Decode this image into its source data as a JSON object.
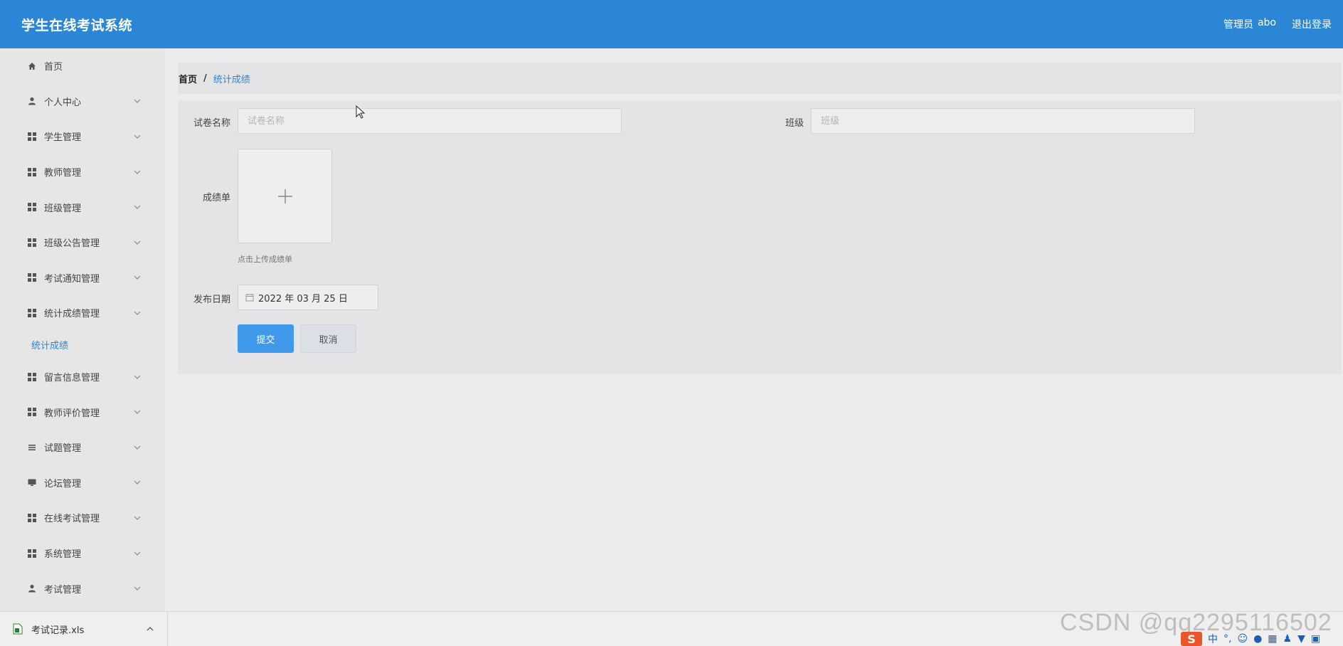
{
  "app": {
    "title": "学生在线考试系统",
    "admin_label": "管理员",
    "admin_name": "abo",
    "logout": "退出登录"
  },
  "sidebar": {
    "items": [
      {
        "label": "首页",
        "icon": "home-icon"
      },
      {
        "label": "个人中心",
        "icon": "user-icon"
      },
      {
        "label": "学生管理",
        "icon": "grid-icon"
      },
      {
        "label": "教师管理",
        "icon": "grid-icon"
      },
      {
        "label": "班级管理",
        "icon": "grid-icon"
      },
      {
        "label": "班级公告管理",
        "icon": "grid-icon"
      },
      {
        "label": "考试通知管理",
        "icon": "grid-icon"
      },
      {
        "label": "统计成绩管理",
        "icon": "grid-icon"
      },
      {
        "label": "统计成绩",
        "icon": ""
      },
      {
        "label": "留言信息管理",
        "icon": "grid-icon"
      },
      {
        "label": "教师评价管理",
        "icon": "grid-icon"
      },
      {
        "label": "试题管理",
        "icon": "list-icon"
      },
      {
        "label": "论坛管理",
        "icon": "monitor-icon"
      },
      {
        "label": "在线考试管理",
        "icon": "grid-icon"
      },
      {
        "label": "系统管理",
        "icon": "grid-icon"
      },
      {
        "label": "考试管理",
        "icon": "user-icon"
      }
    ]
  },
  "breadcrumb": {
    "home": "首页",
    "separator": "/",
    "current": "统计成绩"
  },
  "form": {
    "paper_name_label": "试卷名称",
    "paper_name_placeholder": "试卷名称",
    "class_label": "班级",
    "class_placeholder": "班级",
    "score_sheet_label": "成绩单",
    "upload_hint": "点击上传成绩单",
    "publish_date_label": "发布日期",
    "publish_date_value": "2022 年 03 月 25 日",
    "submit_label": "提交",
    "cancel_label": "取消"
  },
  "download_bar": {
    "file_name": "考试记录.xls"
  },
  "watermark": "CSDN @qq2295116502",
  "tray": {
    "ime_mode": "中",
    "punct": "°,"
  },
  "colors": {
    "topbar": "#2b86d6",
    "accent": "#2b86d6",
    "submit_button": "#3f98e9"
  }
}
